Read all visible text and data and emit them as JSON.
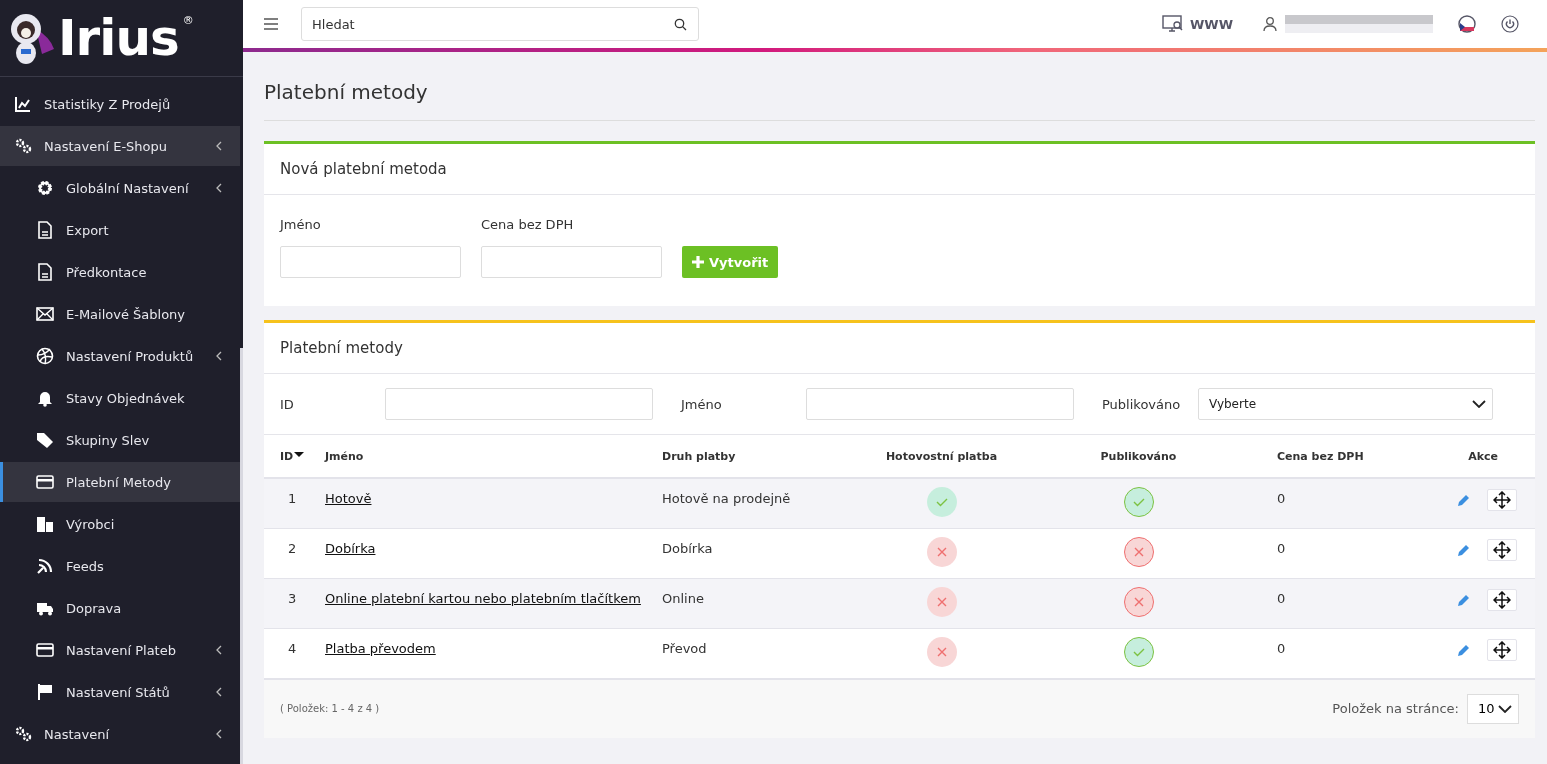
{
  "logo": {
    "text": "Irius",
    "mark": "®"
  },
  "sidebar": {
    "items": [
      {
        "label": "Statistiky Z Prodejů",
        "selected": false,
        "chevron": false
      },
      {
        "label": "Nastavení E-Shopu",
        "selected": false,
        "chevron": true,
        "expanded": true,
        "children": [
          {
            "label": "Globální Nastavení",
            "selected": false,
            "chevron": true
          },
          {
            "label": "Export",
            "selected": false,
            "chevron": false
          },
          {
            "label": "Předkontace",
            "selected": false,
            "chevron": false
          },
          {
            "label": "E-Mailové Šablony",
            "selected": false,
            "chevron": false
          },
          {
            "label": "Nastavení Produktů",
            "selected": false,
            "chevron": true
          },
          {
            "label": "Stavy Objednávek",
            "selected": false,
            "chevron": false
          },
          {
            "label": "Skupiny Slev",
            "selected": false,
            "chevron": false
          },
          {
            "label": "Platební Metody",
            "selected": true,
            "chevron": false
          },
          {
            "label": "Výrobci",
            "selected": false,
            "chevron": false
          },
          {
            "label": "Feeds",
            "selected": false,
            "chevron": false
          },
          {
            "label": "Doprava",
            "selected": false,
            "chevron": false
          },
          {
            "label": "Nastavení Plateb",
            "selected": false,
            "chevron": true
          },
          {
            "label": "Nastavení Států",
            "selected": false,
            "chevron": true
          }
        ]
      },
      {
        "label": "Nastavení",
        "selected": false,
        "chevron": true
      }
    ]
  },
  "topbar": {
    "search": {
      "placeholder": "Hledat"
    },
    "www": "WWW"
  },
  "page_title": "Platební metody",
  "new_card": {
    "title": "Nová platební metoda",
    "fields": [
      {
        "label": "Jméno"
      },
      {
        "label": "Cena bez DPH"
      }
    ],
    "button": "Vytvořit"
  },
  "list_card": {
    "title": "Platební metody",
    "filters": [
      {
        "label": "ID",
        "kind": "text"
      },
      {
        "label": "Jméno",
        "kind": "text"
      },
      {
        "label": "Publikováno",
        "kind": "select",
        "value": "Vyberte"
      }
    ],
    "columns": [
      "ID",
      "Jméno",
      "Druh platby",
      "Hotovostní platba",
      "Publikováno",
      "Cena bez DPH",
      "Akce"
    ],
    "rows": [
      {
        "id": "1",
        "name": "Hotově",
        "type": "Hotově na prodejně",
        "cash": true,
        "published": true,
        "price": "0"
      },
      {
        "id": "2",
        "name": "Dobírka",
        "type": "Dobírka",
        "cash": false,
        "published": false,
        "price": "0"
      },
      {
        "id": "3",
        "name": "Online platební kartou nebo platebním tlačítkem",
        "type": "Online",
        "cash": false,
        "published": false,
        "price": "0"
      },
      {
        "id": "4",
        "name": "Platba převodem",
        "type": "Převod",
        "cash": false,
        "published": true,
        "price": "0"
      }
    ],
    "summary": "( Položek: 1 - 4 z 4 )",
    "per_page_label": "Položek na stránce:",
    "per_page": "10"
  }
}
